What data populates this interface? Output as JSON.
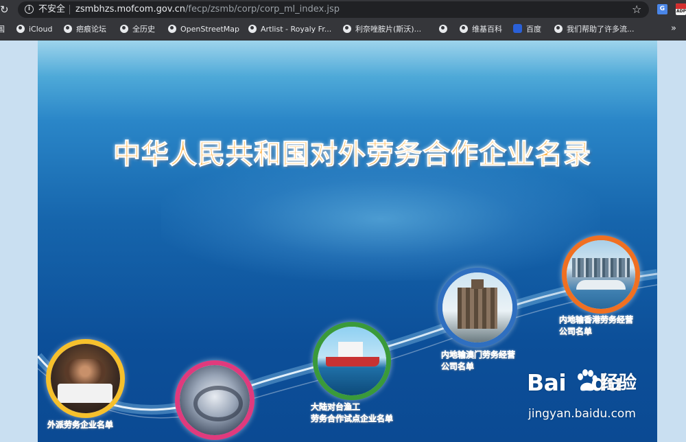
{
  "browser": {
    "security_label": "不安全",
    "url_host": "zsmbhzs.mofcom.gov.cn",
    "url_path": "/fecp/zsmb/corp/corp_ml_index.jsp",
    "bookmarks": [
      {
        "label": "国",
        "icon": "globe-icon"
      },
      {
        "label": "iCloud",
        "icon": "globe-icon"
      },
      {
        "label": "疤痕论坛",
        "icon": "globe-icon"
      },
      {
        "label": "全历史",
        "icon": "globe-icon"
      },
      {
        "label": "OpenStreetMap",
        "icon": "globe-icon"
      },
      {
        "label": "Artlist - Royaly Fr...",
        "icon": "globe-icon"
      },
      {
        "label": "利奈唑胺片(斯沃)...",
        "icon": "globe-icon"
      },
      {
        "label": "维基百科",
        "icon": "globe-icon"
      },
      {
        "label": "百度",
        "icon": "baidu-paw-icon"
      },
      {
        "label": "我们帮助了许多流...",
        "icon": "globe-icon"
      }
    ],
    "more_label": "»"
  },
  "page": {
    "title": "中华人民共和国对外劳务合作企业名录",
    "categories": [
      {
        "line1": "外派劳务企业名单",
        "line2": "",
        "ring_color": "#f6c02c"
      },
      {
        "line1": "",
        "line2": "",
        "ring_color": "#e03a7d"
      },
      {
        "line1": "大陆对台渔工",
        "line2": "劳务合作试点企业名单",
        "ring_color": "#3a9a3a"
      },
      {
        "line1": "内地输澳门劳务经营",
        "line2": "公司名单",
        "ring_color": "#2f6fc0"
      },
      {
        "line1": "内地输香港劳务经营",
        "line2": "公司名单",
        "ring_color": "#f07022"
      }
    ]
  },
  "watermark": {
    "logo": "Bai",
    "logo_tail": "du",
    "product": "经验",
    "domain": "jingyan.baidu.com"
  },
  "colors": {
    "chrome_bg": "#35363a",
    "title_orange": "#ffb347",
    "banner_blue": "#0c4f99"
  }
}
